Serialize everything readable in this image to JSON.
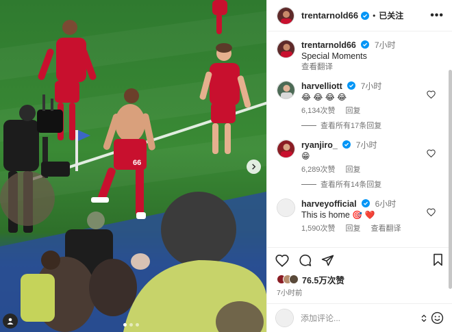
{
  "post": {
    "author": "trentarnold66",
    "follow_status": "已关注",
    "separator": "•",
    "more_label": "•••"
  },
  "caption": {
    "username": "trentarnold66",
    "time": "7小时",
    "text": "Special Moments",
    "translate": "查看翻译"
  },
  "comments": [
    {
      "username": "harvelliott",
      "verified": true,
      "time": "7小时",
      "text": "😂 😂 😂 😂",
      "likes": "6,134次赞",
      "reply": "回复",
      "view_replies": "查看所有17条回复"
    },
    {
      "username": "ryanjiro_",
      "verified": true,
      "time": "7小时",
      "text": "😁",
      "likes": "6,289次赞",
      "reply": "回复",
      "view_replies": "查看所有14条回复"
    },
    {
      "username": "harveyofficial",
      "verified": true,
      "time": "6小时",
      "text": "This is home",
      "text_emoji": "🎯 ❤️",
      "likes": "1,590次赞",
      "reply": "回复",
      "translate": "查看翻译"
    }
  ],
  "engagement": {
    "likes": "76.5万次赞",
    "posted": "7小时前"
  },
  "composer": {
    "placeholder": "添加评论..."
  },
  "colors": {
    "verified": "#0095f6",
    "jersey": "#c8102e",
    "heart": "#ed4956"
  },
  "icons": [
    "verified-icon",
    "heart-icon",
    "comment-icon",
    "share-icon",
    "bookmark-icon",
    "emoji-icon",
    "chevron-right-icon",
    "user-tag-icon"
  ]
}
